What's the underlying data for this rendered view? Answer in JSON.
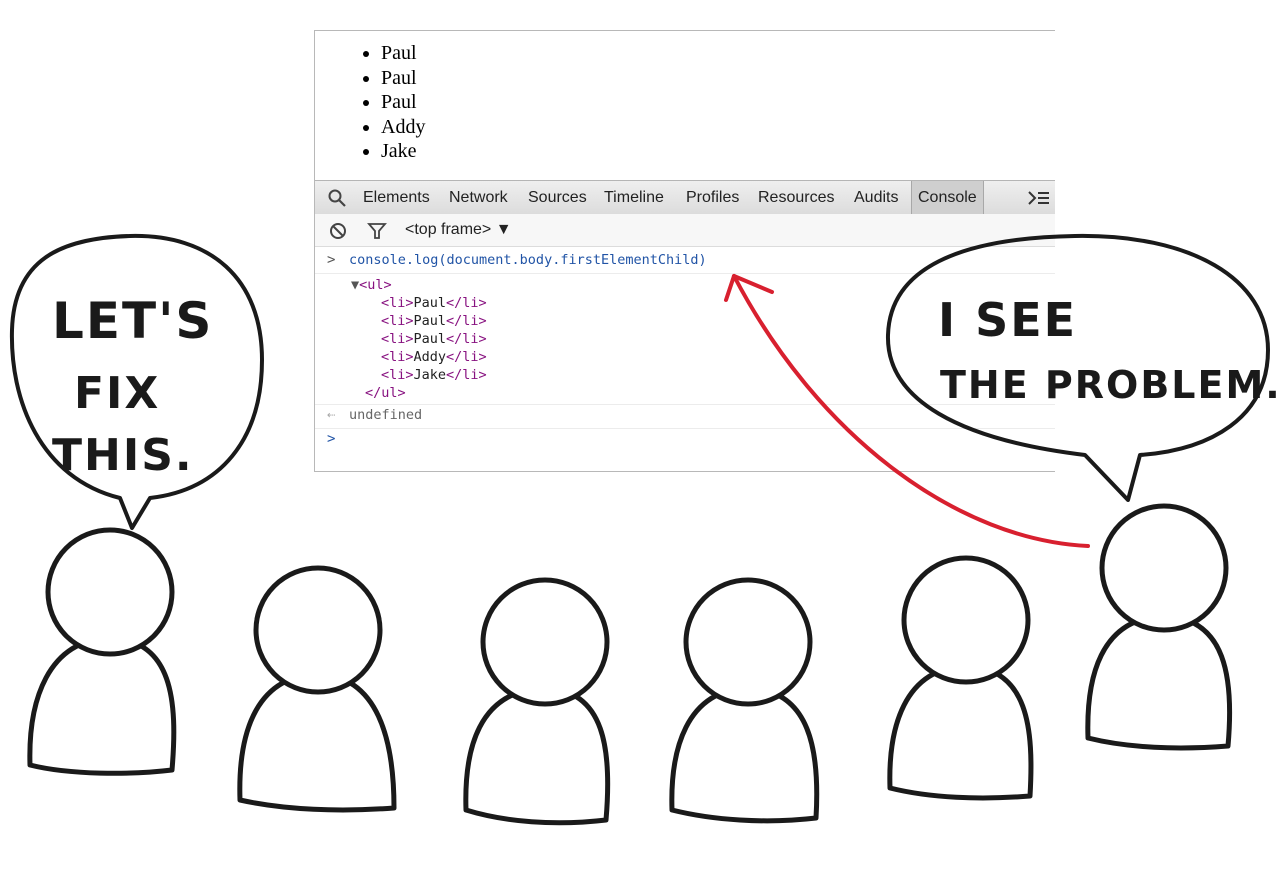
{
  "page_list": [
    "Paul",
    "Paul",
    "Paul",
    "Addy",
    "Jake"
  ],
  "devtools": {
    "tabs": [
      "Elements",
      "Network",
      "Sources",
      "Timeline",
      "Profiles",
      "Resources",
      "Audits",
      "Console"
    ],
    "active_tab": "Console",
    "context": "<top frame> ▼",
    "command": "console.log(document.body.firstElementChild)",
    "output": {
      "open_tag": "<ul>",
      "items": [
        "Paul",
        "Paul",
        "Paul",
        "Addy",
        "Jake"
      ],
      "li_open": "<li>",
      "li_close": "</li>",
      "close_tag": "</ul>"
    },
    "result": "undefined",
    "colors": {
      "command": "#2154a6",
      "tag": "#881280",
      "toolbar": "#dcdcdc"
    }
  },
  "bubbles": {
    "left": [
      "LET'S",
      "FIX",
      "THIS."
    ],
    "right": [
      "I SEE",
      "THE PROBLEM."
    ]
  },
  "colors": {
    "arrow": "#d8202f",
    "ink": "#1a1a1a"
  }
}
